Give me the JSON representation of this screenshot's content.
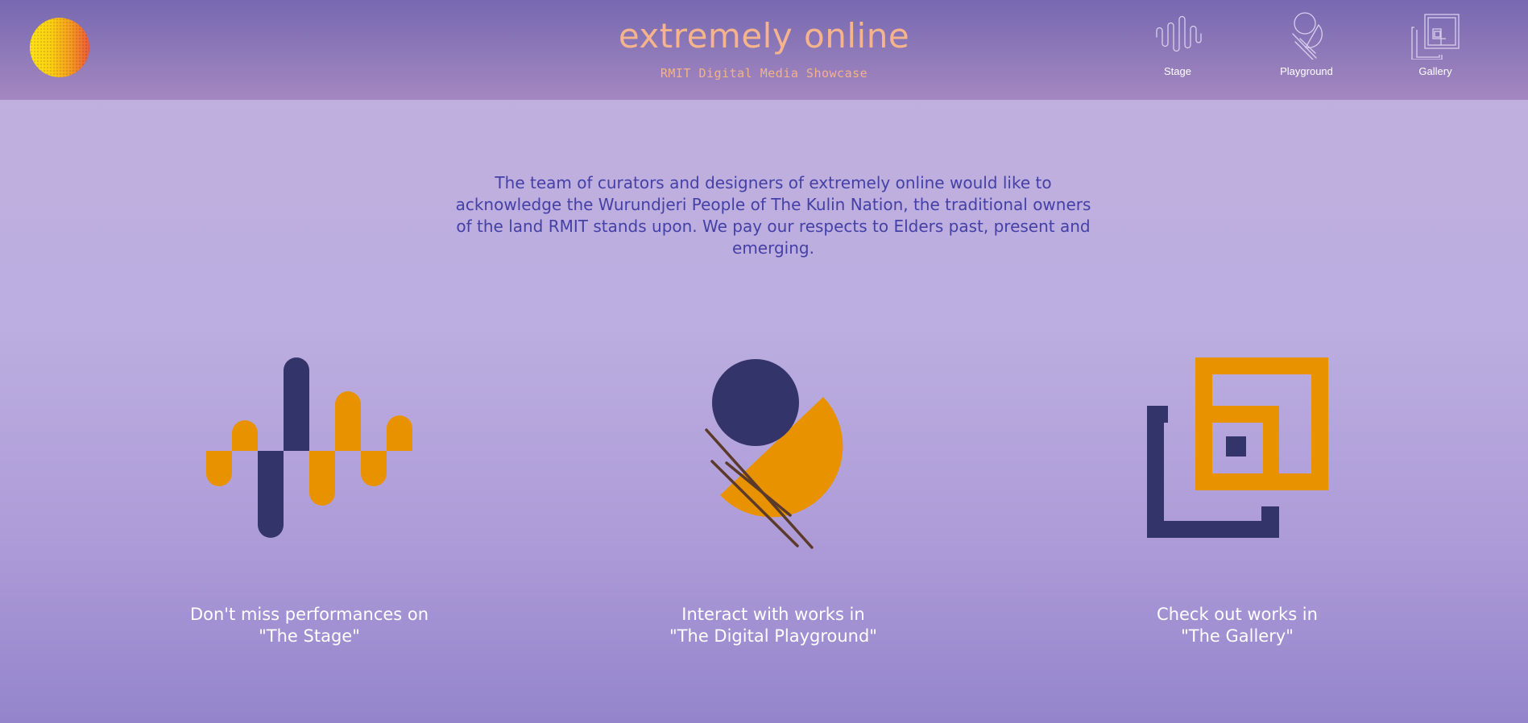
{
  "header": {
    "logo_icon": "gradient-sun-logo",
    "title": "extremely online",
    "subtitle": "RMIT Digital Media Showcase",
    "nav": [
      {
        "label": "Stage",
        "icon": "waveform-icon"
      },
      {
        "label": "Playground",
        "icon": "circle-and-lines-icon"
      },
      {
        "label": "Gallery",
        "icon": "nested-squares-icon"
      }
    ]
  },
  "acknowledgement": "The team of curators and designers of extremely online would like to acknowledge the Wurundjeri People of The Kulin Nation, the traditional owners of the land RMIT stands upon. We pay our respects to Elders past, present and emerging.",
  "features": [
    {
      "icon": "waveform-icon",
      "line1": "Don't miss performances on",
      "line2": "\"The Stage\""
    },
    {
      "icon": "circle-and-lines-icon",
      "line1": "Interact with works in",
      "line2": "\"The Digital Playground\""
    },
    {
      "icon": "nested-squares-icon",
      "line1": "Check out works in",
      "line2": "\"The Gallery\""
    }
  ],
  "colors": {
    "accent_orange": "#e99200",
    "navy": "#33356a",
    "title_peach": "#f5b48c",
    "ack_text": "#4440a6",
    "line_brown": "#5b3a2a"
  }
}
